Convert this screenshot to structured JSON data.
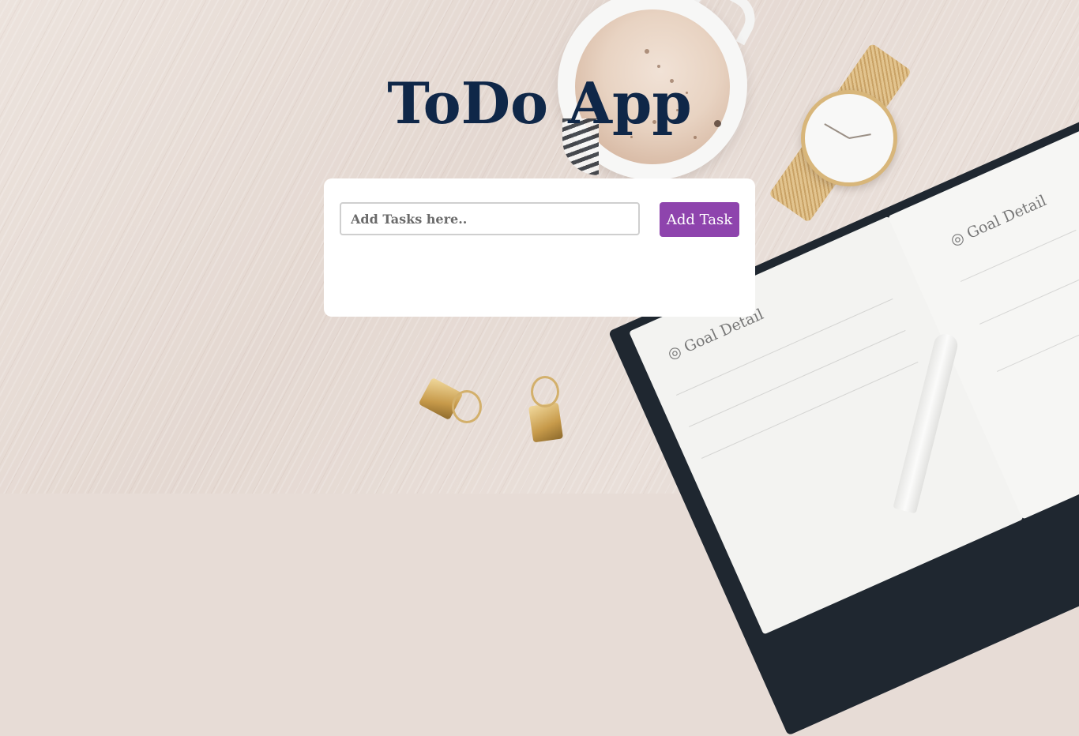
{
  "app": {
    "title": "ToDo App"
  },
  "form": {
    "input_placeholder": "Add Tasks here..",
    "input_value": "",
    "add_button_label": "Add Task"
  },
  "tasks": [],
  "colors": {
    "title": "#0f2748",
    "button": "#8e44ad",
    "card": "#ffffff"
  }
}
